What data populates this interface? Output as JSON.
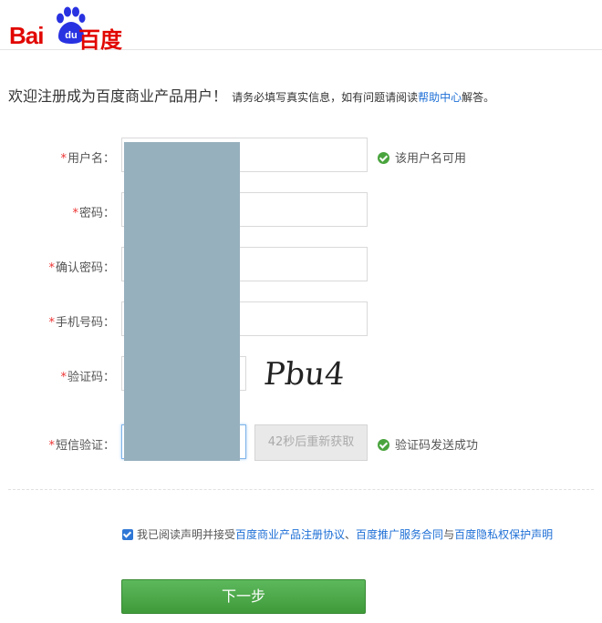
{
  "brand": {
    "logo_latin": "Bai",
    "logo_paw_text": "du",
    "logo_cn": "百度",
    "color": "#e10601"
  },
  "welcome": {
    "title": "欢迎注册成为百度商业产品用户！",
    "sub_prefix": "请务必填写真实信息，如有问题请阅读",
    "help_link": "帮助中心",
    "sub_suffix": "解答。"
  },
  "form": {
    "required_mark": "*",
    "username": {
      "label": "用户名：",
      "value": "",
      "tip": "该用户名可用"
    },
    "password": {
      "label": "密码：",
      "value": ""
    },
    "confirm_password": {
      "label": "确认密码：",
      "value": ""
    },
    "phone": {
      "label": "手机号码：",
      "value": ""
    },
    "captcha": {
      "label": "验证码：",
      "value": "",
      "image_text": "Pbu4"
    },
    "sms": {
      "label": "短信验证：",
      "value": "",
      "button": "42秒后重新获取",
      "tip": "验证码发送成功"
    }
  },
  "agreement": {
    "prefix": "我已阅读声明并接受",
    "link1": "百度商业产品注册协议",
    "sep1": "、",
    "link2": "百度推广服务合同",
    "sep2": "与",
    "link3": "百度隐私权保护声明",
    "checked": true
  },
  "next_button": "下一步",
  "colors": {
    "accent_link": "#1e6fd6",
    "success": "#4aa43e",
    "required": "#e33",
    "primary_button": "#4aa43e"
  }
}
